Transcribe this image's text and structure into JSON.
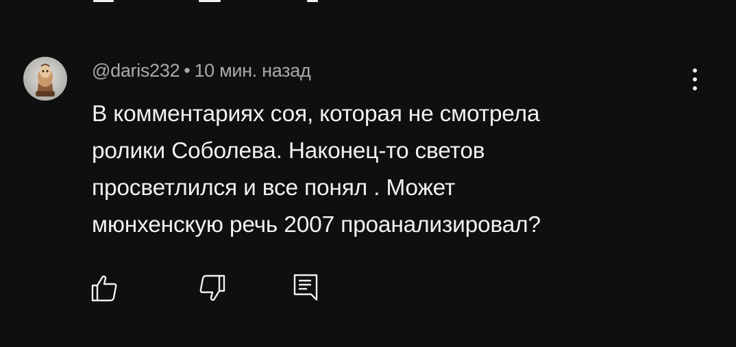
{
  "comment": {
    "author": "@daris232",
    "separator": "•",
    "timestamp": "10 мин. назад",
    "text": "В комментариях соя, которая не смотрела\nролики Соболева. Наконец-то светов\nпросветлился и все понял . Может\nмюнхенскую речь 2007 проанализировал?"
  },
  "icons": {
    "avatar": "avatar-image",
    "more": "more-vert-icon",
    "like": "thumbs-up-icon",
    "dislike": "thumbs-down-icon",
    "reply": "reply-comment-icon"
  },
  "colors": {
    "background": "#0f0f0f",
    "text_primary": "#f1f1f1",
    "text_secondary": "#aaaaaa"
  }
}
